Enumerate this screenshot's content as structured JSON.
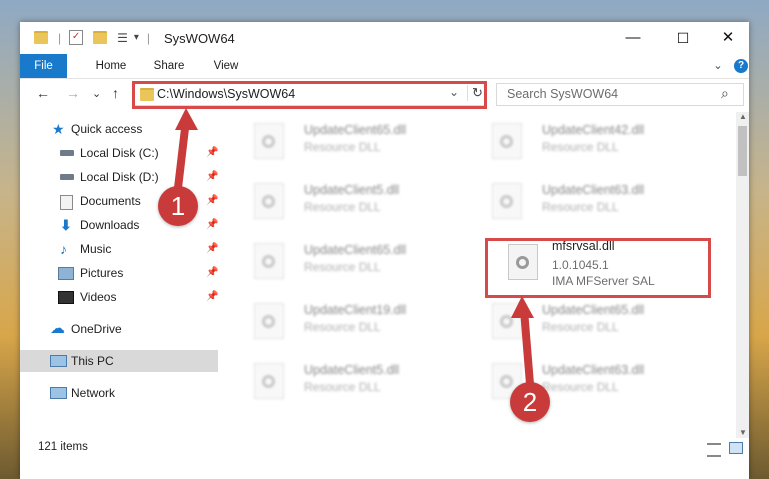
{
  "window": {
    "title": "SysWOW64"
  },
  "titlebar": {
    "minimize": "—",
    "maximize": "☐",
    "close": "✕"
  },
  "ribbon": {
    "tabs": [
      "File",
      "Home",
      "Share",
      "View"
    ],
    "expand": "⌄",
    "help": "?"
  },
  "nav": {
    "back": "←",
    "forward": "→",
    "recent": "⌄",
    "up": "↑",
    "address": "C:\\Windows\\SysWOW64",
    "address_dropdown": "⌄",
    "refresh": "↻",
    "search_placeholder": "Search SysWOW64",
    "search_icon": "⌕"
  },
  "sidebar": {
    "items": [
      {
        "label": "Quick access",
        "icon": "star-icon"
      },
      {
        "label": "Local Disk (C:)",
        "icon": "drive-icon"
      },
      {
        "label": "Local Disk (D:)",
        "icon": "drive-icon"
      },
      {
        "label": "Documents",
        "icon": "documents-icon"
      },
      {
        "label": "Downloads",
        "icon": "download-icon"
      },
      {
        "label": "Music",
        "icon": "music-icon"
      },
      {
        "label": "Pictures",
        "icon": "pictures-icon"
      },
      {
        "label": "Videos",
        "icon": "videos-icon"
      },
      {
        "label": "OneDrive",
        "icon": "cloud-icon"
      },
      {
        "label": "This PC",
        "icon": "computer-icon"
      },
      {
        "label": "Network",
        "icon": "network-icon"
      }
    ],
    "pin": "📌"
  },
  "files": [
    {
      "name": "UpdateClient65.dll",
      "desc": "Resource DLL"
    },
    {
      "name": "UpdateClient42.dll",
      "desc": "Resource DLL"
    },
    {
      "name": "UpdateClient5.dll",
      "desc": "Resource DLL"
    },
    {
      "name": "UpdateClient63.dll",
      "desc": "Resource DLL"
    },
    {
      "name": "UpdateClient65.dll",
      "desc": "Resource DLL"
    },
    {
      "name": "mfsrvsal.dll",
      "version": "1.0.1045.1",
      "company": "IMA MFServer SAL"
    },
    {
      "name": "UpdateClient19.dll",
      "desc": "Resource DLL"
    },
    {
      "name": "UpdateClient65.dll",
      "desc": "Resource DLL"
    },
    {
      "name": "UpdateClient5.dll",
      "desc": "Resource DLL"
    },
    {
      "name": "UpdateClient63.dll",
      "desc": "Resource DLL"
    }
  ],
  "status": {
    "count": "121 items"
  },
  "callouts": [
    "1",
    "2"
  ]
}
